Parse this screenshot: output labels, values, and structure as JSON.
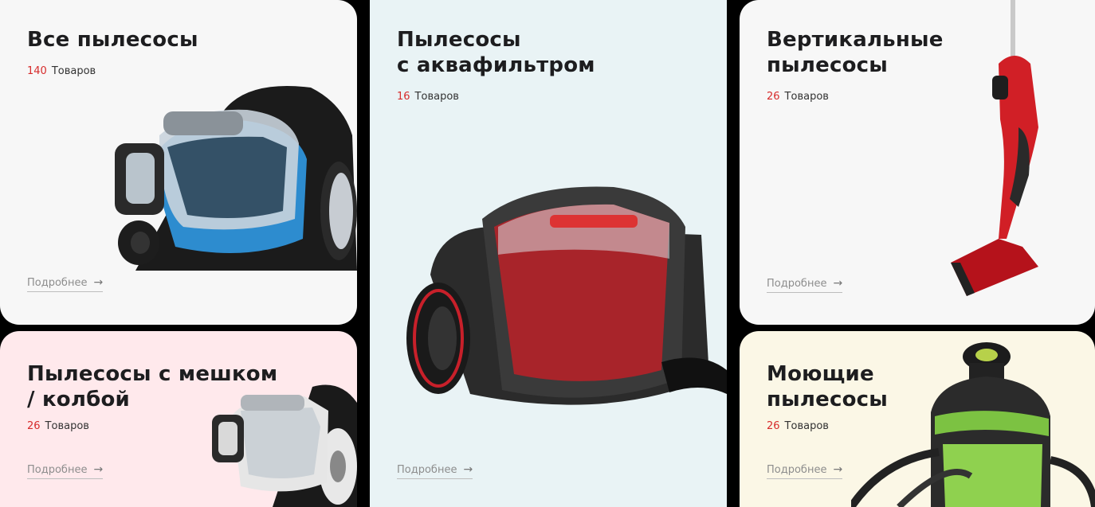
{
  "cards": [
    {
      "title": "Все пылесосы",
      "count": "140",
      "count_label": "Товаров",
      "link": "Подробнее",
      "arrow": "→",
      "image": "blue-canister-vacuum"
    },
    {
      "title": "Пылесосы с мешком\n/ колбой",
      "count": "26",
      "count_label": "Товаров",
      "link": "Подробнее",
      "arrow": "→",
      "image": "white-canister-vacuum"
    },
    {
      "title": "Пылесосы\nс аквафильтром",
      "count": "16",
      "count_label": "Товаров",
      "link": "Подробнее",
      "arrow": "→",
      "image": "red-aquafilter-vacuum"
    },
    {
      "title": "Вертикальные\nпылесосы",
      "count": "26",
      "count_label": "Товаров",
      "link": "Подробнее",
      "arrow": "→",
      "image": "red-stick-vacuum"
    },
    {
      "title": "Моющие\nпылесосы",
      "count": "26",
      "count_label": "Товаров",
      "link": "Подробнее",
      "arrow": "→",
      "image": "green-washing-vacuum"
    }
  ],
  "colors": {
    "accent": "#d62b2b",
    "text": "#1d1d1f",
    "muted": "#8d8d8d"
  }
}
